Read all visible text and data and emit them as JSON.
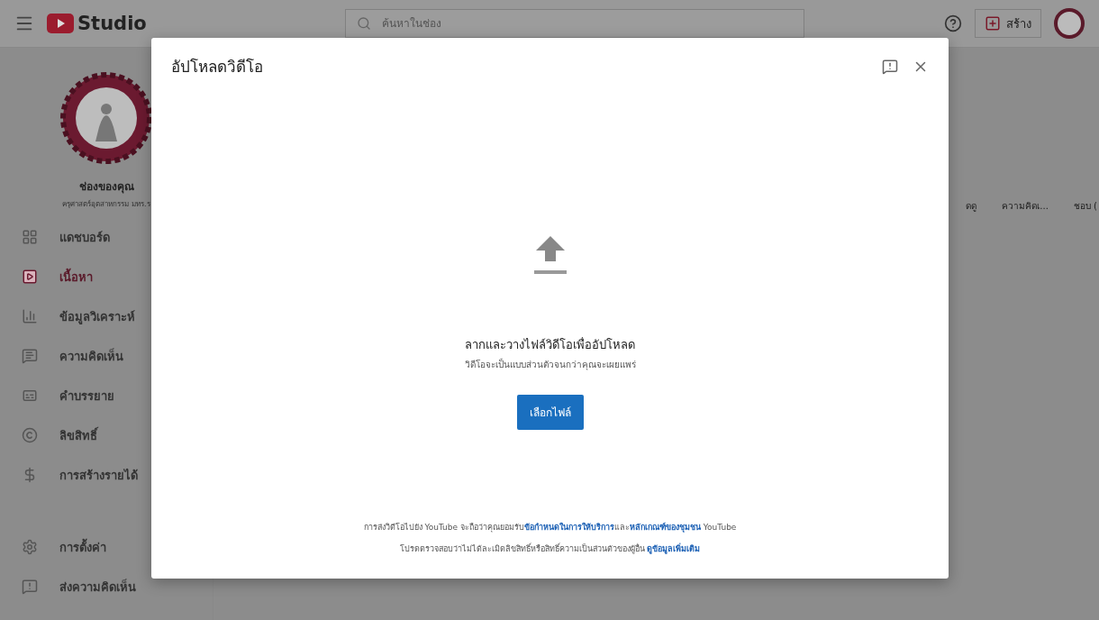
{
  "topbar": {
    "brand": "Studio",
    "search": {
      "placeholder": "ค้นหาในช่อง"
    },
    "create_button": "สร้าง"
  },
  "sidebar": {
    "channel_title": "ช่องของคุณ",
    "channel_name": "ครุศาสตร์อุตสาหกรรม มทร.ร",
    "items": [
      {
        "label": "แดชบอร์ด",
        "selected": false
      },
      {
        "label": "เนื้อหา",
        "selected": true
      },
      {
        "label": "ข้อมูลวิเคราะห์",
        "selected": false
      },
      {
        "label": "ความคิดเห็น",
        "selected": false
      },
      {
        "label": "คำบรรยาย",
        "selected": false
      },
      {
        "label": "ลิขสิทธิ์",
        "selected": false
      },
      {
        "label": "การสร้างรายได้",
        "selected": false
      },
      {
        "label": "การตั้งค่า",
        "selected": false
      },
      {
        "label": "ส่งความคิดเห็น",
        "selected": false
      }
    ]
  },
  "table": {
    "columns": [
      "ดดู",
      "ความคิดเ...",
      "ชอบ ("
    ]
  },
  "dialog": {
    "title": "อัปโหลดวิดีโอ",
    "heading": "ลากและวางไฟล์วิดีโอเพื่ออัปโหลด",
    "subheading": "วิดีโอจะเป็นแบบส่วนตัวจนกว่าคุณจะเผยแพร่",
    "button": "เลือกไฟล์",
    "footer": [
      [
        {
          "text": "การส่งวิดีโอไปยัง YouTube จะถือว่าคุณยอมรับ",
          "kind": "text"
        },
        {
          "text": "ข้อกำหนดในการให้บริการ",
          "kind": "link"
        },
        {
          "text": "และ",
          "kind": "text"
        },
        {
          "text": "หลักเกณฑ์ของชุมชน",
          "kind": "link"
        },
        {
          "text": " YouTube",
          "kind": "text"
        }
      ],
      [
        {
          "text": "โปรดตรวจสอบว่าไม่ได้ละเมิดลิขสิทธิ์หรือสิทธิ์ความเป็นส่วนตัวของผู้อื่น ",
          "kind": "text"
        },
        {
          "text": "ดูข้อมูลเพิ่มเติม",
          "kind": "link"
        }
      ]
    ]
  }
}
